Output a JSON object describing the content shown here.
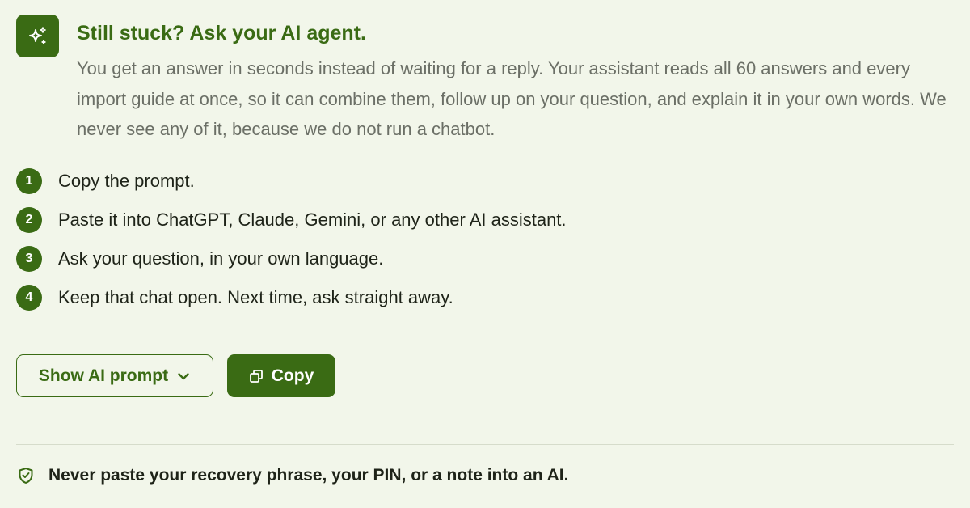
{
  "header": {
    "icon": "sparkle-icon",
    "title": "Still stuck? Ask your AI agent.",
    "description": "You get an answer in seconds instead of waiting for a reply. Your assistant reads all 60 answers and every import guide at once, so it can combine them, follow up on your question, and explain it in your own words. We never see any of it, because we do not run a chatbot."
  },
  "steps": [
    {
      "number": "1",
      "text": "Copy the prompt."
    },
    {
      "number": "2",
      "text": "Paste it into ChatGPT, Claude, Gemini, or any other AI assistant."
    },
    {
      "number": "3",
      "text": "Ask your question, in your own language."
    },
    {
      "number": "4",
      "text": "Keep that chat open. Next time, ask straight away."
    }
  ],
  "actions": {
    "show_prompt_label": "Show AI prompt",
    "show_prompt_icon": "chevron-down-icon",
    "copy_label": "Copy",
    "copy_icon": "copy-icon"
  },
  "warning": {
    "icon": "shield-check-icon",
    "text": "Never paste your recovery phrase, your PIN, or a note into an AI."
  },
  "colors": {
    "background": "#f2f6ea",
    "accent": "#3a6b14",
    "body_text": "#6b6f66",
    "text": "#1e2318"
  }
}
